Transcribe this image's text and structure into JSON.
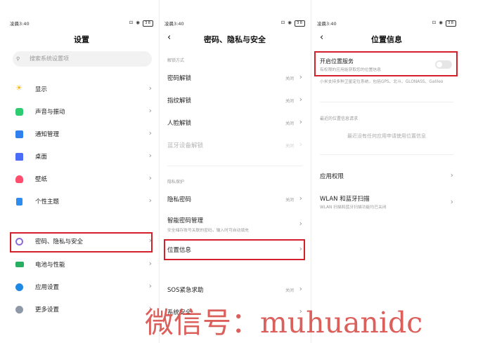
{
  "status_bar": {
    "time": "凌晨3:40",
    "icons": "⊡ ◉",
    "battery": "38"
  },
  "settings": {
    "title": "设置",
    "search_placeholder": "搜索系统设置项",
    "items": [
      {
        "label": "显示",
        "icon": "sun-icon",
        "color": "#f5b400"
      },
      {
        "label": "声音与振动",
        "icon": "speaker-icon",
        "color": "#2ecc71"
      },
      {
        "label": "通知管理",
        "icon": "notification-icon",
        "color": "#2f80ed"
      },
      {
        "label": "桌面",
        "icon": "home-icon",
        "color": "#4a6cf7"
      },
      {
        "label": "壁纸",
        "icon": "flower-icon",
        "color": "#ff4d6d"
      },
      {
        "label": "个性主题",
        "icon": "brush-icon",
        "color": "#2d8cf0"
      },
      {
        "label": "密码、隐私与安全",
        "icon": "fingerprint-icon",
        "color": "#8e6bd8"
      },
      {
        "label": "电池与性能",
        "icon": "battery-icon",
        "color": "#27ae60"
      },
      {
        "label": "应用设置",
        "icon": "gear-icon",
        "color": "#1e88e5"
      },
      {
        "label": "更多设置",
        "icon": "more-icon",
        "color": "#8e99a8"
      }
    ]
  },
  "security": {
    "title": "密码、隐私与安全",
    "section_unlock": "解锁方式",
    "unlock_items": [
      {
        "label": "密码解锁",
        "value": "关闭"
      },
      {
        "label": "指纹解锁",
        "value": "关闭"
      },
      {
        "label": "人脸解锁",
        "value": "关闭"
      },
      {
        "label": "蓝牙设备解锁",
        "value": "关闭"
      }
    ],
    "section_privacy": "隐私保护",
    "privacy_password": {
      "label": "隐私密码",
      "value": "关闭"
    },
    "smart_password": {
      "label": "智能密码管理",
      "sub": "安全储存账号关联的密码，输入时可自动填充"
    },
    "location": {
      "label": "位置信息"
    },
    "sos": {
      "label": "SOS紧急求助",
      "value": "关闭"
    },
    "system_security": {
      "label": "系统安全"
    }
  },
  "location_page": {
    "title": "位置信息",
    "toggle": {
      "label": "开启位置服务",
      "sub": "有权限的应用能获取您的位置信息",
      "state": "off"
    },
    "gnss_note": "小米支持多种卫星定位系统，包括GPS、北斗、GLONASS、Galileo",
    "recent_header": "最近的位置信息请求",
    "recent_empty": "最近没有任何应用申请使用位置信息",
    "app_permission": {
      "label": "应用权限"
    },
    "wlan_scan": {
      "label": "WLAN 和蓝牙扫描",
      "sub": "WLAN 扫描和蓝牙扫描功能均已关闭"
    }
  },
  "watermark": "微信号：muhuanidc",
  "colors": {
    "highlight": "#d3202a",
    "watermark": "#d9534f"
  }
}
